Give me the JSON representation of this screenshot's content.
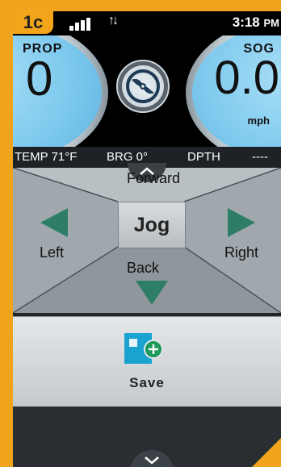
{
  "badge": "1c",
  "status": {
    "time": "3:18",
    "ampm": "PM"
  },
  "gauges": {
    "prop": {
      "label": "PROP",
      "value": "0"
    },
    "sog": {
      "label": "SOG",
      "value": "0.0",
      "unit": "mph"
    }
  },
  "info": {
    "temp": "TEMP 71°F",
    "brg": "BRG  0°",
    "depth_label": "DPTH",
    "depth_value": "----"
  },
  "jog": {
    "forward": "Forward",
    "left": "Left",
    "jog": "Jog",
    "right": "Right",
    "back": "Back"
  },
  "save": {
    "label": "Save"
  },
  "colors": {
    "accent": "#f0a31c",
    "arrow": "#2e7d66",
    "gauge": "#86cdef",
    "save_icon": "#1aa3d1",
    "save_plus": "#1c9a5a"
  },
  "icons": [
    "signal-icon",
    "data-transfer-icon",
    "propeller-icon",
    "chevron-up-icon",
    "arrow-left-icon",
    "arrow-right-icon",
    "arrow-down-icon",
    "save-waypoint-icon",
    "chevron-down-icon"
  ]
}
